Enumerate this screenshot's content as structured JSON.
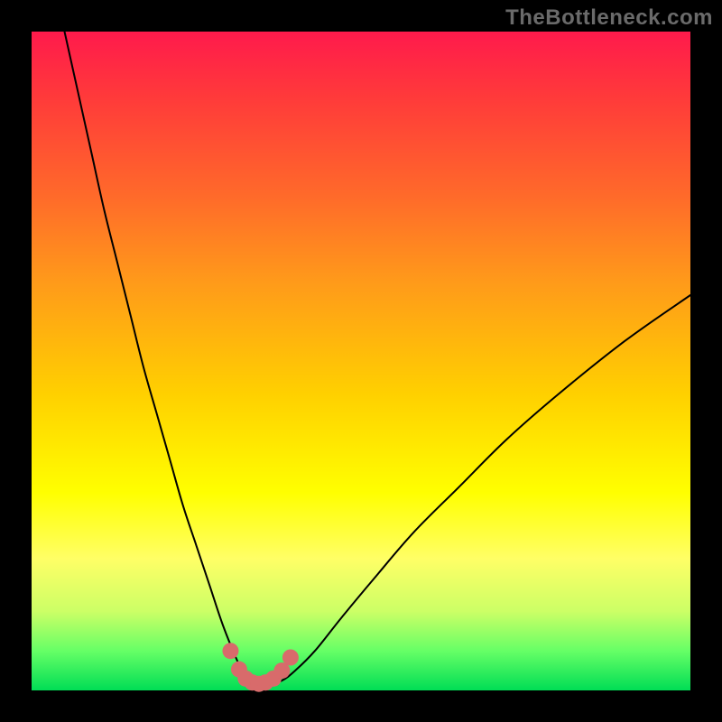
{
  "watermark": "TheBottleneck.com",
  "chart_data": {
    "type": "line",
    "title": "",
    "xlabel": "",
    "ylabel": "",
    "xlim": [
      0,
      100
    ],
    "ylim": [
      0,
      100
    ],
    "grid": false,
    "legend": false,
    "background_gradient": {
      "top": "#ff1a4c",
      "middle": "#ffff00",
      "bottom": "#00dd55"
    },
    "series": [
      {
        "name": "bottleneck-curve",
        "color": "#000000",
        "stroke_width": 2,
        "x": [
          5,
          7,
          9,
          11,
          13,
          15,
          17,
          19,
          21,
          23,
          25,
          27,
          29,
          31,
          32,
          33,
          34,
          36,
          38,
          40,
          43,
          47,
          52,
          58,
          65,
          72,
          80,
          90,
          100
        ],
        "y_pct": [
          100,
          91,
          82,
          73,
          65,
          57,
          49,
          42,
          35,
          28,
          22,
          16,
          10,
          5,
          3,
          1.5,
          1,
          1,
          1.5,
          3,
          6,
          11,
          17,
          24,
          31,
          38,
          45,
          53,
          60
        ]
      },
      {
        "name": "highlight-dots",
        "color": "#d86b6b",
        "type": "scatter",
        "marker_size": 9,
        "x": [
          30.2,
          31.5,
          32.5,
          33.5,
          34.5,
          35.5,
          36.7,
          38.0,
          39.3
        ],
        "y_pct": [
          6.0,
          3.2,
          1.8,
          1.2,
          1.0,
          1.2,
          1.8,
          3.0,
          5.0
        ]
      }
    ]
  }
}
